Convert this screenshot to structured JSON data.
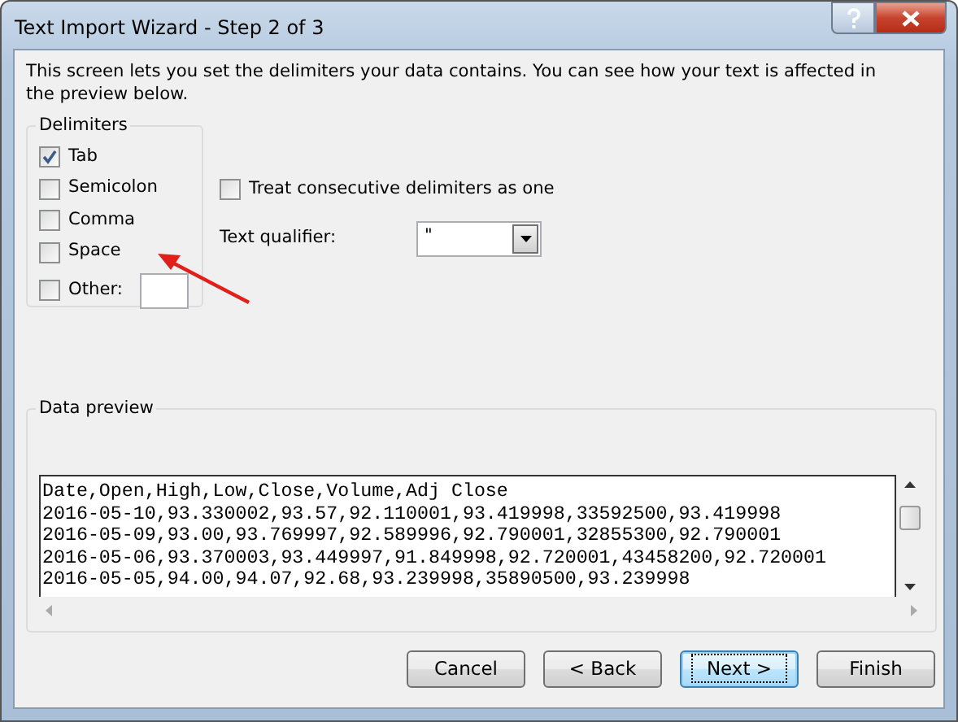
{
  "window": {
    "title": "Text Import Wizard - Step 2 of 3"
  },
  "intro": "This screen lets you set the delimiters your data contains.  You can see how your text is affected in the preview below.",
  "delimiters": {
    "title": "Delimiters",
    "items": [
      {
        "kind": "checkbox",
        "label": "Tab",
        "checked": true
      },
      {
        "kind": "checkbox",
        "label": "Semicolon",
        "checked": false
      },
      {
        "kind": "checkbox",
        "label": "Comma",
        "checked": false
      },
      {
        "kind": "checkbox",
        "label": "Space",
        "checked": false
      },
      {
        "kind": "checkbox_field",
        "label": "Other:",
        "checked": false
      }
    ]
  },
  "consecutive": {
    "label": "Treat consecutive delimiters as one",
    "checked": false
  },
  "qualifier": {
    "label": "Text qualifier:",
    "value": "\""
  },
  "preview": {
    "title": "Data preview",
    "lines": [
      "Date,Open,High,Low,Close,Volume,Adj Close",
      "2016-05-10,93.330002,93.57,92.110001,93.419998,33592500,93.419998",
      "2016-05-09,93.00,93.769997,92.589996,92.790001,32855300,92.790001",
      "2016-05-06,93.370003,93.449997,91.849998,92.720001,43458200,92.720001",
      "2016-05-05,94.00,94.07,92.68,93.239998,35890500,93.239998"
    ]
  },
  "buttons": [
    {
      "label": "Cancel",
      "focused": false
    },
    {
      "label": "< Back",
      "focused": false
    },
    {
      "label": "Next >",
      "focused": true
    },
    {
      "label": "Finish",
      "focused": false
    }
  ]
}
